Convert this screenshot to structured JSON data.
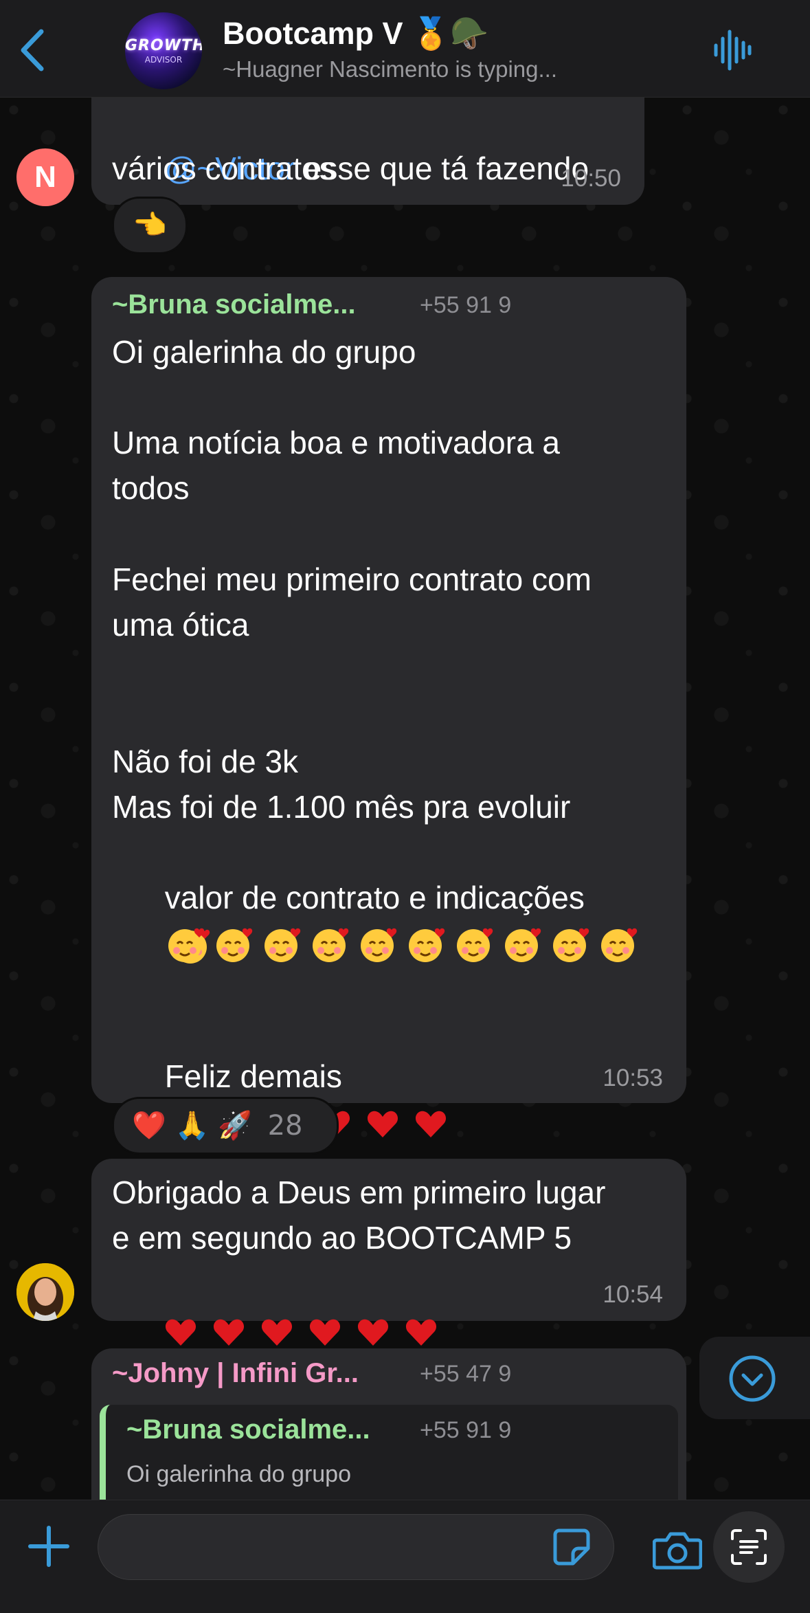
{
  "header": {
    "title": "Bootcamp V 🏅🪖",
    "subtitle": "~Huagner Nascimento is typing...",
    "avatar_text": "GROWTH",
    "avatar_sub": "ADVISOR"
  },
  "messages": [
    {
      "avatar_letter": "N",
      "mention": "@~Victor",
      "text_rest": " esse que tá fazendo",
      "line2": "vários contratos",
      "time": "10:50",
      "reaction": "👈"
    },
    {
      "sender": "~Bruna socialme...",
      "phone": "+55 91 9",
      "lines": [
        "Oi galerinha do grupo",
        "",
        "Uma notícia boa e motivadora a",
        "todos",
        "",
        "Fechei meu primeiro contrato com",
        "uma ótica",
        "",
        "",
        "Não foi de 3k",
        "Mas foi de 1.100 mês pra evoluir",
        "valor de contrato e indicações"
      ],
      "blush_count": 11,
      "last_line": "Feliz demais",
      "heart_count": 6,
      "time": "10:53",
      "reactions": "❤️ 🙏 🚀",
      "reaction_count": "28"
    },
    {
      "line1": "Obrigado a Deus em primeiro lugar",
      "line2": "e em segundo ao BOOTCAMP 5",
      "heart_count": 6,
      "time": "10:54"
    },
    {
      "sender": "~Johny | Infini Gr...",
      "phone": "+55 47 9",
      "quote_sender": "~Bruna socialme...",
      "quote_phone": "+55 91 9",
      "quote_text": "Oi galerinha do grupo"
    }
  ],
  "colors": {
    "accent": "#3a9bd9",
    "sender_green": "#9be39a",
    "sender_pink": "#f59ac7",
    "heart": "#e0191f"
  },
  "icons": [
    "back-chevron-icon",
    "voice-wave-icon",
    "plus-icon",
    "sticker-icon",
    "camera-icon",
    "text-scan-icon",
    "scroll-down-icon"
  ]
}
